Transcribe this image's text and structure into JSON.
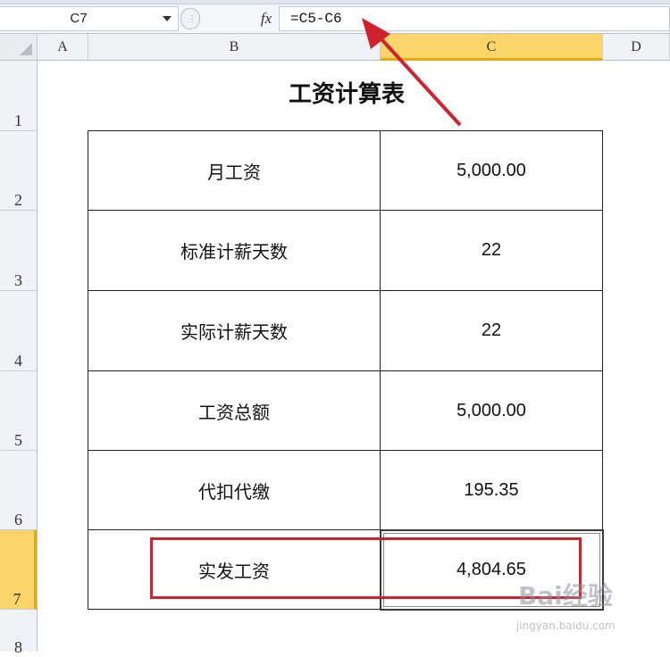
{
  "formula_bar": {
    "name_box": "C7",
    "fx_label": "fx",
    "formula": "=C5-C6"
  },
  "columns": [
    "A",
    "B",
    "C",
    "D"
  ],
  "selected_column": "C",
  "rows": [
    "1",
    "2",
    "3",
    "4",
    "5",
    "6",
    "7",
    "8"
  ],
  "selected_row": "7",
  "sheet": {
    "title": "工资计算表",
    "table": [
      {
        "label": "月工资",
        "value": "5,000.00"
      },
      {
        "label": "标准计薪天数",
        "value": "22"
      },
      {
        "label": "实际计薪天数",
        "value": "22"
      },
      {
        "label": "工资总额",
        "value": "5,000.00"
      },
      {
        "label": "代扣代缴",
        "value": "195.35"
      },
      {
        "label": "实发工资",
        "value": "4,804.65"
      }
    ]
  },
  "watermark": {
    "logo": "Bai经验",
    "url": "jingyan.baidu.com"
  },
  "colors": {
    "selection_header": "#fbd56a",
    "highlight_box": "#d0222e",
    "arrow": "#d0222e"
  }
}
